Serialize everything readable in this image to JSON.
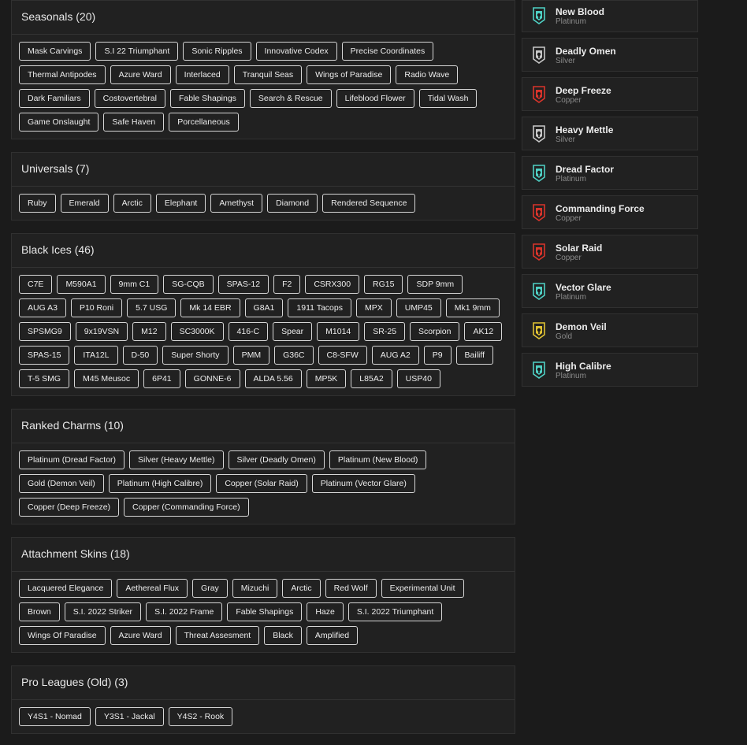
{
  "sections": [
    {
      "title": "Seasonals (20)",
      "items": [
        "Mask Carvings",
        "S.I 22 Triumphant",
        "Sonic Ripples",
        "Innovative Codex",
        "Precise Coordinates",
        "Thermal Antipodes",
        "Azure Ward",
        "Interlaced",
        "Tranquil Seas",
        "Wings of Paradise",
        "Radio Wave",
        "Dark Familiars",
        "Costovertebral",
        "Fable Shapings",
        "Search & Rescue",
        "Lifeblood Flower",
        "Tidal Wash",
        "Game Onslaught",
        "Safe Haven",
        "Porcellaneous"
      ]
    },
    {
      "title": "Universals (7)",
      "items": [
        "Ruby",
        "Emerald",
        "Arctic",
        "Elephant",
        "Amethyst",
        "Diamond",
        "Rendered Sequence"
      ]
    },
    {
      "title": "Black Ices (46)",
      "items": [
        "C7E",
        "M590A1",
        "9mm C1",
        "SG-CQB",
        "SPAS-12",
        "F2",
        "CSRX300",
        "RG15",
        "SDP 9mm",
        "AUG A3",
        "P10 Roni",
        "5.7 USG",
        "Mk 14 EBR",
        "G8A1",
        "1911 Tacops",
        "MPX",
        "UMP45",
        "Mk1 9mm",
        "SPSMG9",
        "9x19VSN",
        "M12",
        "SC3000K",
        "416-C",
        "Spear",
        "M1014",
        "SR-25",
        "Scorpion",
        "AK12",
        "SPAS-15",
        "ITA12L",
        "D-50",
        "Super Shorty",
        "PMM",
        "G36C",
        "C8-SFW",
        "AUG A2",
        "P9",
        "Bailiff",
        "T-5 SMG",
        "M45 Meusoc",
        "6P41",
        "GONNE-6",
        "ALDA 5.56",
        "MP5K",
        "L85A2",
        "USP40"
      ]
    },
    {
      "title": "Ranked Charms (10)",
      "items": [
        "Platinum (Dread Factor)",
        "Silver (Heavy Mettle)",
        "Silver (Deadly Omen)",
        "Platinum (New Blood)",
        "Gold (Demon Veil)",
        "Platinum (High Calibre)",
        "Copper (Solar Raid)",
        "Platinum (Vector Glare)",
        "Copper (Deep Freeze)",
        "Copper (Commanding Force)"
      ]
    },
    {
      "title": "Attachment Skins (18)",
      "items": [
        "Lacquered Elegance",
        "Aethereal Flux",
        "Gray",
        "Mizuchi",
        "Arctic",
        "Red Wolf",
        "Experimental Unit",
        "Brown",
        "S.I. 2022 Striker",
        "S.I. 2022 Frame",
        "Fable Shapings",
        "Haze",
        "S.I. 2022 Triumphant",
        "Wings Of Paradise",
        "Azure Ward",
        "Threat Assesment",
        "Black",
        "Amplified"
      ]
    },
    {
      "title": "Pro Leagues (Old) (3)",
      "items": [
        "Y4S1 - Nomad",
        "Y3S1 - Jackal",
        "Y4S2 - Rook"
      ]
    }
  ],
  "ranks": [
    {
      "name": "New Blood",
      "tier": "Platinum",
      "icon": "platinum-rank-icon",
      "color": "#4fd1c5"
    },
    {
      "name": "Deadly Omen",
      "tier": "Silver",
      "icon": "silver-rank-icon",
      "color": "#c8c8c8"
    },
    {
      "name": "Deep Freeze",
      "tier": "Copper",
      "icon": "copper-rank-icon",
      "color": "#d9342b"
    },
    {
      "name": "Heavy Mettle",
      "tier": "Silver",
      "icon": "silver-rank-icon",
      "color": "#c8c8c8"
    },
    {
      "name": "Dread Factor",
      "tier": "Platinum",
      "icon": "platinum-rank-icon",
      "color": "#4fd1c5"
    },
    {
      "name": "Commanding Force",
      "tier": "Copper",
      "icon": "copper-rank-icon",
      "color": "#d9342b"
    },
    {
      "name": "Solar Raid",
      "tier": "Copper",
      "icon": "copper-rank-icon",
      "color": "#d9342b"
    },
    {
      "name": "Vector Glare",
      "tier": "Platinum",
      "icon": "platinum-rank-icon",
      "color": "#4fd1c5"
    },
    {
      "name": "Demon Veil",
      "tier": "Gold",
      "icon": "gold-rank-icon",
      "color": "#e0c233"
    },
    {
      "name": "High Calibre",
      "tier": "Platinum",
      "icon": "platinum-rank-icon",
      "color": "#4fd1c5"
    }
  ]
}
